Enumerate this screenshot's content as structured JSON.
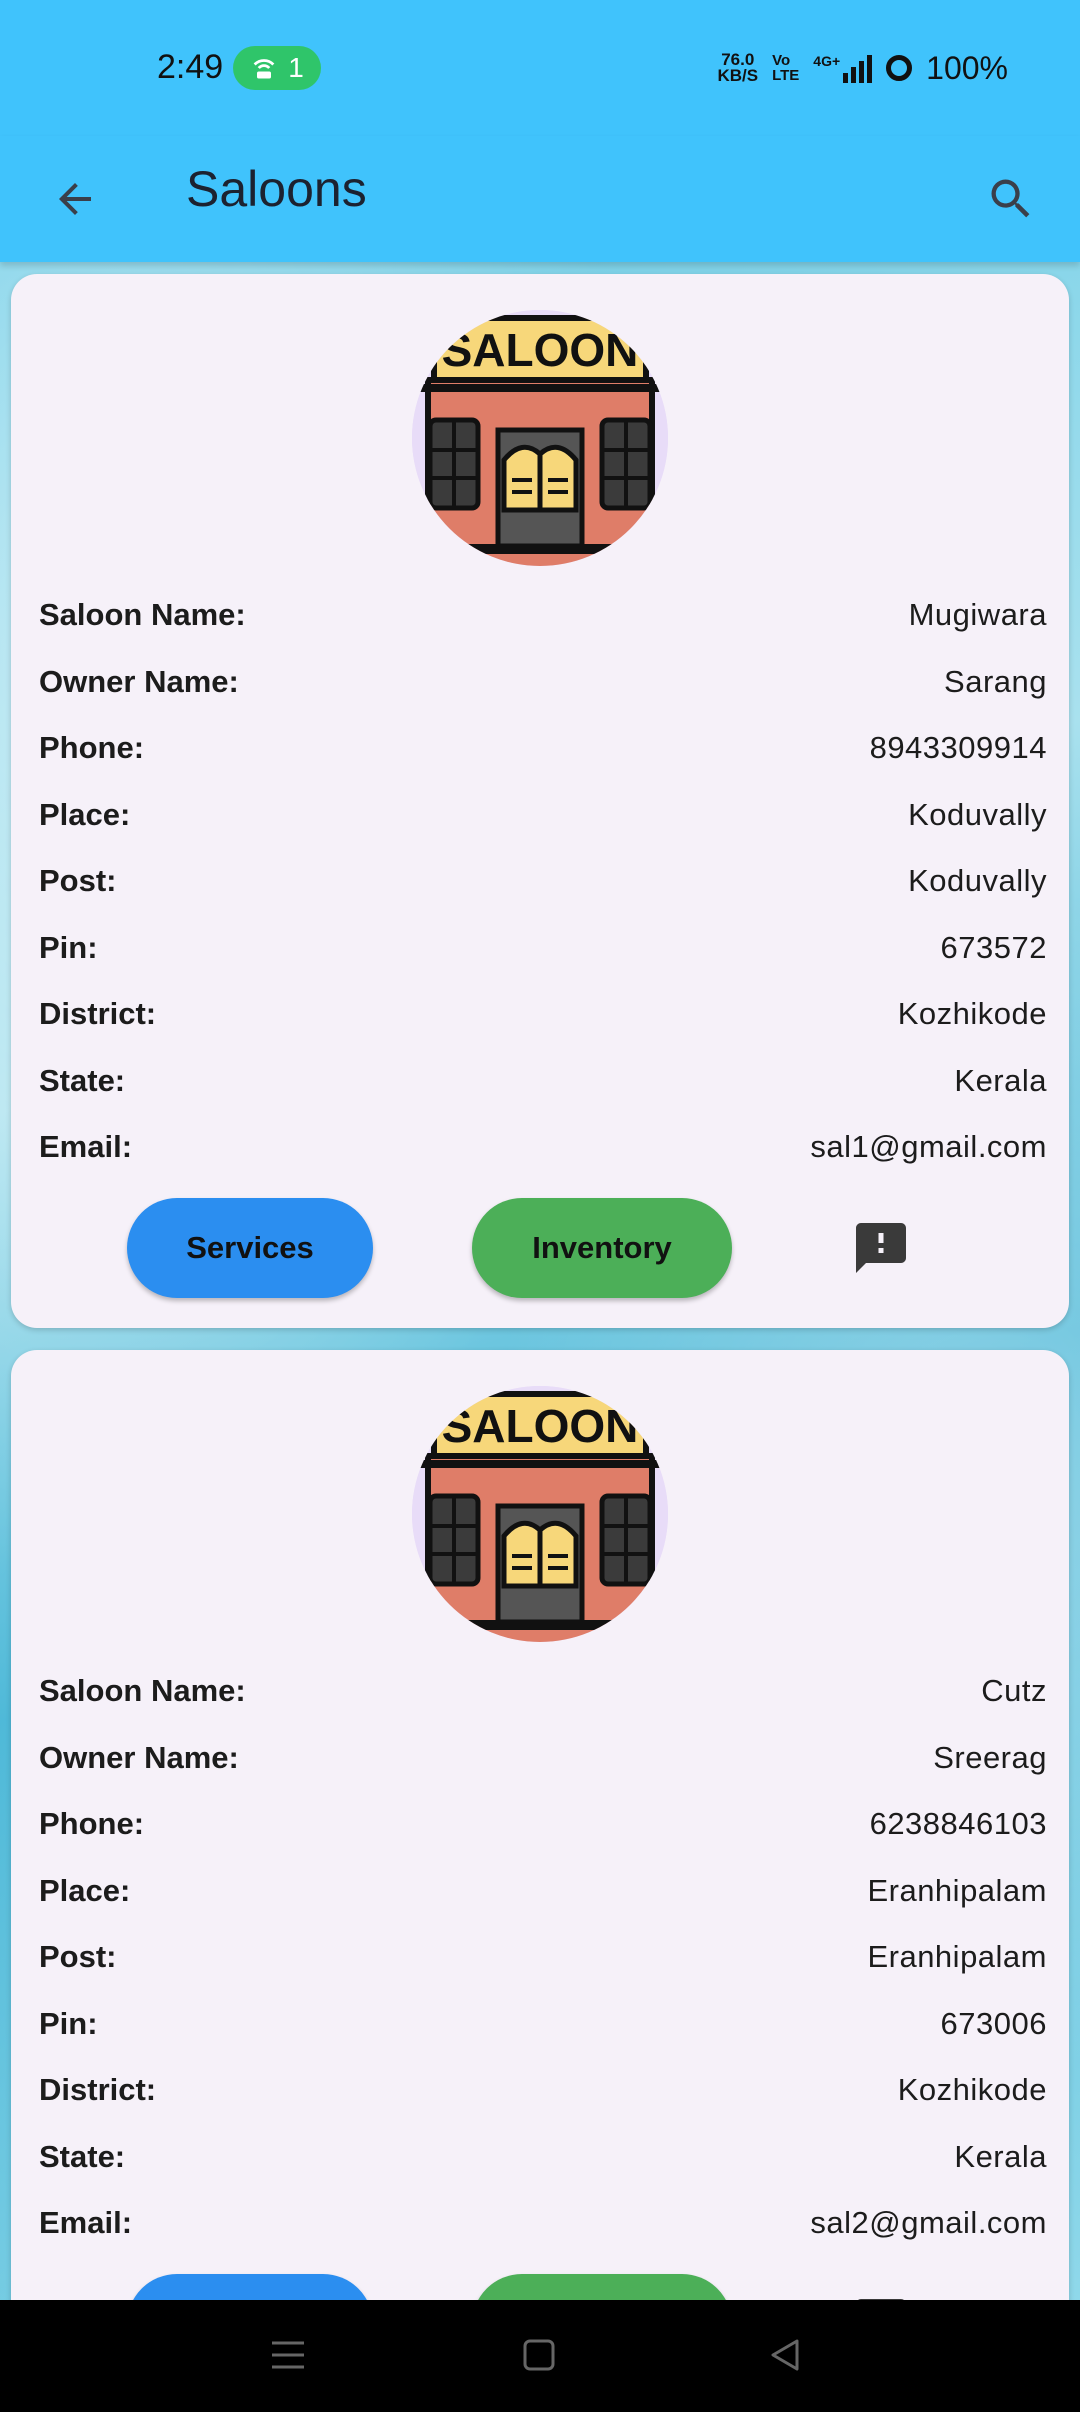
{
  "status_bar": {
    "time": "2:49",
    "hotspot_count": "1",
    "net_speed_value": "76.0",
    "net_speed_unit": "KB/S",
    "volte_top": "Vo",
    "volte_bottom": "LTE",
    "network": "4G+",
    "battery": "100%"
  },
  "app_bar": {
    "title": "Saloons"
  },
  "icons": {
    "back": "arrow-back-icon",
    "search": "search-icon",
    "feedback": "feedback-icon",
    "saloon_image": "saloon-building-icon",
    "saloon_sign": "SALOON"
  },
  "labels": {
    "saloon_name": "Saloon Name:",
    "owner_name": "Owner Name:",
    "phone": "Phone:",
    "place": "Place:",
    "post": "Post:",
    "pin": "Pin:",
    "district": "District:",
    "state": "State:",
    "email": "Email:"
  },
  "buttons": {
    "services": "Services",
    "inventory": "Inventory"
  },
  "saloons": [
    {
      "saloon_name": "Mugiwara",
      "owner_name": "Sarang",
      "phone": "8943309914",
      "place": "Koduvally",
      "post": "Koduvally",
      "pin": "673572",
      "district": "Kozhikode",
      "state": "Kerala",
      "email": "sal1@gmail.com"
    },
    {
      "saloon_name": "Cutz",
      "owner_name": "Sreerag",
      "phone": "6238846103",
      "place": "Eranhipalam",
      "post": "Eranhipalam",
      "pin": "673006",
      "district": "Kozhikode",
      "state": "Kerala",
      "email": "sal2@gmail.com"
    }
  ],
  "colors": {
    "app_bar": "#40c3fc",
    "card": "#f6f1f9",
    "services_button": "#2b8ef0",
    "inventory_button": "#4caf58"
  }
}
